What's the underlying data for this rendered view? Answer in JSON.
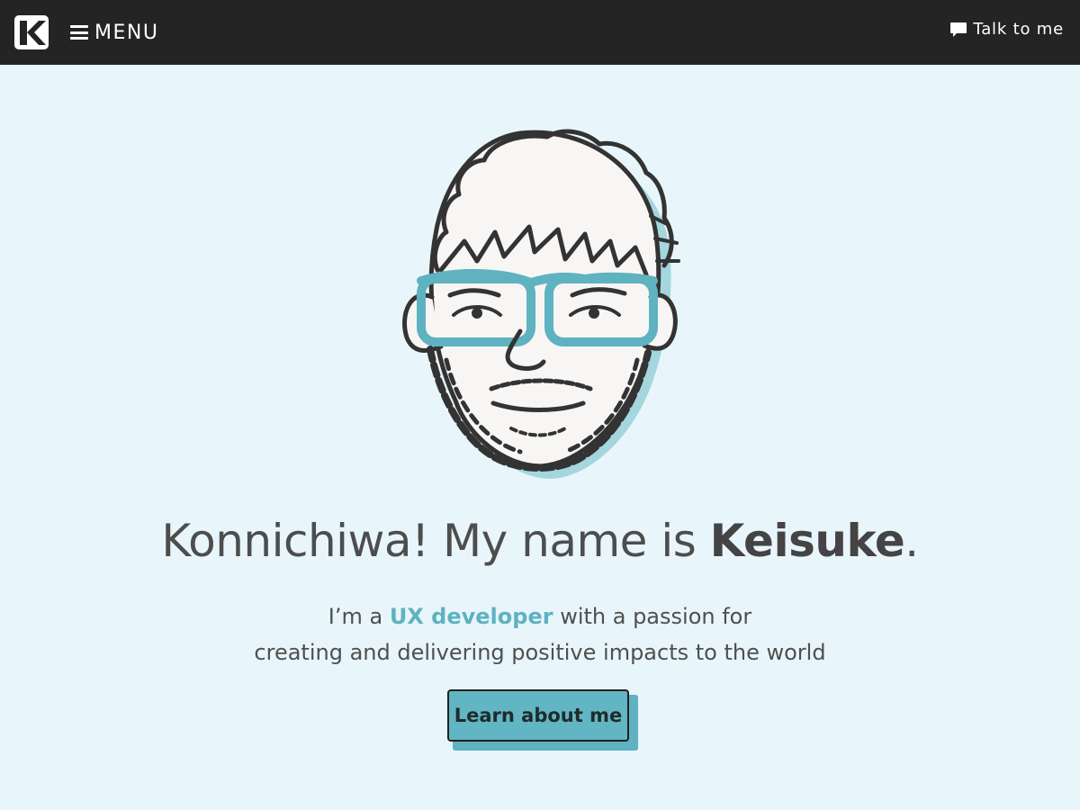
{
  "header": {
    "logo_letter": "K",
    "menu_label": "MENU",
    "talk_label": "Talk to me"
  },
  "hero": {
    "headline_pre": "Konnichiwa! My name is ",
    "headline_name": "Keisuke",
    "headline_post": ".",
    "intro_pre": "I’m a ",
    "intro_highlight": "UX developer",
    "intro_post": " with a passion for",
    "intro_line2": "creating and delivering positive impacts to the world",
    "cta_label": "Learn about me"
  },
  "colors": {
    "topbar": "#242424",
    "background": "#e8f6fb",
    "accent": "#5fb2c0",
    "text": "#4b4b4b"
  },
  "icons": {
    "logo": "k-logo-icon",
    "menu": "hamburger-icon",
    "talk": "speech-bubble-icon",
    "portrait": "avatar-illustration"
  }
}
